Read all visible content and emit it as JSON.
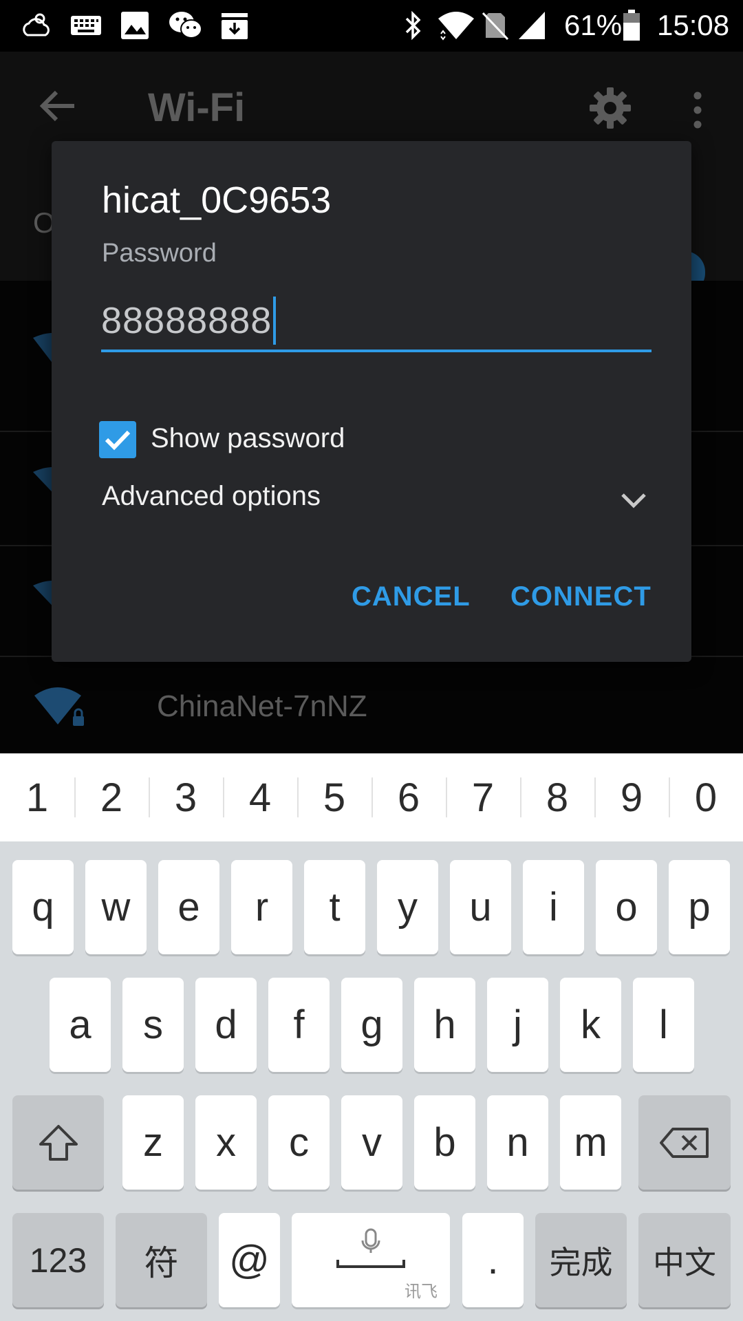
{
  "status_bar": {
    "left_icons": [
      "weather-icon",
      "keyboard-icon",
      "image-icon",
      "wechat-icon",
      "download-icon"
    ],
    "right_icons": [
      "bluetooth-icon",
      "wifi-signal-icon",
      "no-sim-icon",
      "cell-signal-icon",
      "battery-icon"
    ],
    "battery": "61%",
    "time": "15:08"
  },
  "app_bar": {
    "title": "Wi-Fi",
    "back_icon": "back-arrow-icon",
    "settings_icon": "gear-icon",
    "more_icon": "more-vert-icon"
  },
  "background": {
    "partial_label": "O",
    "networks": [
      {
        "name": "ChinaNet-7nNZ",
        "secured": true
      }
    ]
  },
  "dialog": {
    "title": "hicat_0C9653",
    "password_label": "Password",
    "password_value": "88888888",
    "show_password": {
      "label": "Show password",
      "checked": true
    },
    "advanced_options": "Advanced options",
    "cancel": "CANCEL",
    "connect": "CONNECT",
    "accent_color": "#2f9be6"
  },
  "keyboard": {
    "number_row": [
      "1",
      "2",
      "3",
      "4",
      "5",
      "6",
      "7",
      "8",
      "9",
      "0"
    ],
    "row1": [
      "q",
      "w",
      "e",
      "r",
      "t",
      "y",
      "u",
      "i",
      "o",
      "p"
    ],
    "row2": [
      "a",
      "s",
      "d",
      "f",
      "g",
      "h",
      "j",
      "k",
      "l"
    ],
    "row3": [
      "z",
      "x",
      "c",
      "v",
      "b",
      "n",
      "m"
    ],
    "bottom": {
      "numbers": "123",
      "symbols": "符",
      "at": "@",
      "space_brand": "讯飞",
      "period": ".",
      "done": "完成",
      "language": "中文"
    }
  }
}
